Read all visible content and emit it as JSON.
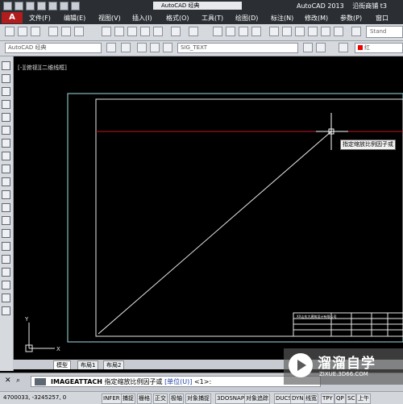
{
  "titlebar": {
    "workspace": "AutoCAD 经典",
    "app_title": "AutoCAD 2013",
    "file_title": "沿街商铺 t3"
  },
  "menu": [
    "文件(F)",
    "编辑(E)",
    "视图(V)",
    "插入(I)",
    "格式(O)",
    "工具(T)",
    "绘图(D)",
    "标注(N)",
    "修改(M)",
    "参数(P)",
    "窗口"
  ],
  "toolbar2": {
    "workspace_select": "AutoCAD 经典",
    "layer_select": "SIG_TEXT",
    "color_select": "红",
    "style_box": "Stand"
  },
  "viewport": {
    "label": "[-][俯视][二维线框]",
    "cursor_tooltip": "指定缩放比例因子或"
  },
  "layout_tabs": [
    "模型",
    "布局1",
    "布局2"
  ],
  "command": {
    "text": "IMAGEATTACH 指定缩放比例因子或 [单位(U)] <1>:",
    "command": "IMAGEATTACH",
    "prompt": "指定缩放比例因子或",
    "option": "[单位(U)]",
    "default": "<1>:"
  },
  "status": {
    "coords": "4700033, -3245257, 0",
    "buttons": [
      "INFER",
      "捕捉",
      "栅格",
      "正交",
      "极轴",
      "对象捕捉",
      "3DOSNAP",
      "对象追踪",
      "DUCS",
      "DYN",
      "线宽",
      "TPY",
      "QP",
      "SC",
      "上午"
    ]
  },
  "title_block": {
    "header": "XX山东大建筑设计有限公司"
  },
  "watermark": {
    "name": "溜溜自学",
    "url": "ZIXUE.3D66.COM"
  },
  "colors": {
    "canvas": "#000000",
    "frame_cyan": "#9fe0e0",
    "crosshair_red": "#c0182a",
    "diagonal": "#e8e8e8"
  }
}
